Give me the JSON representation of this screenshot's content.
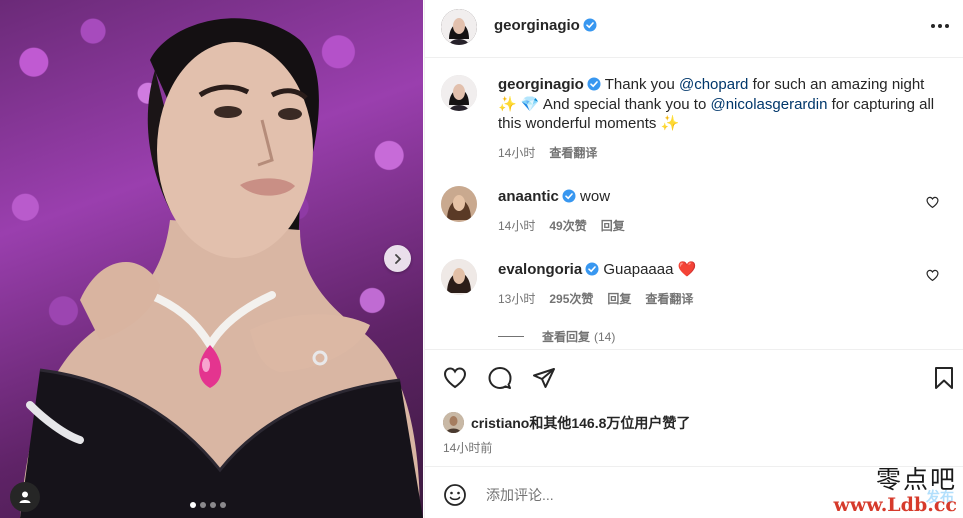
{
  "post": {
    "author": "georginagio",
    "more_icon": "more-horizontal-icon"
  },
  "caption": {
    "username": "georginagio",
    "text_1": "Thank you ",
    "mention_1": "@chopard",
    "text_2": " for such an amazing night ✨ 💎 And special thank you to ",
    "mention_2": "@nicolasgerardin",
    "text_3": " for capturing all this wonderful moments ✨",
    "time": "14小时",
    "translate": "查看翻译"
  },
  "comments": [
    {
      "username": "anaantic",
      "text": "wow",
      "time": "14小时",
      "likes": "49次赞",
      "reply": "回复"
    },
    {
      "username": "evalongoria",
      "text": "Guapaaaa ❤️",
      "time": "13小时",
      "likes": "295次赞",
      "reply": "回复",
      "translate": "查看翻译"
    }
  ],
  "view_replies": {
    "label": "查看回复",
    "count": "(14)"
  },
  "likes": {
    "user": "cristiano",
    "rest": "和其他146.8万位用户赞了"
  },
  "timestamp": "14小时前",
  "add_comment": {
    "placeholder": "添加评论...",
    "post_label": "发布"
  },
  "carousel": {
    "slides": 4,
    "active": 1
  },
  "watermark": {
    "line1": "零点吧",
    "line2": "www.Ldb.cc"
  },
  "colors": {
    "verified": "#3897f0",
    "mention": "#00376b",
    "heart": "#ed4956",
    "muted": "#737373"
  }
}
